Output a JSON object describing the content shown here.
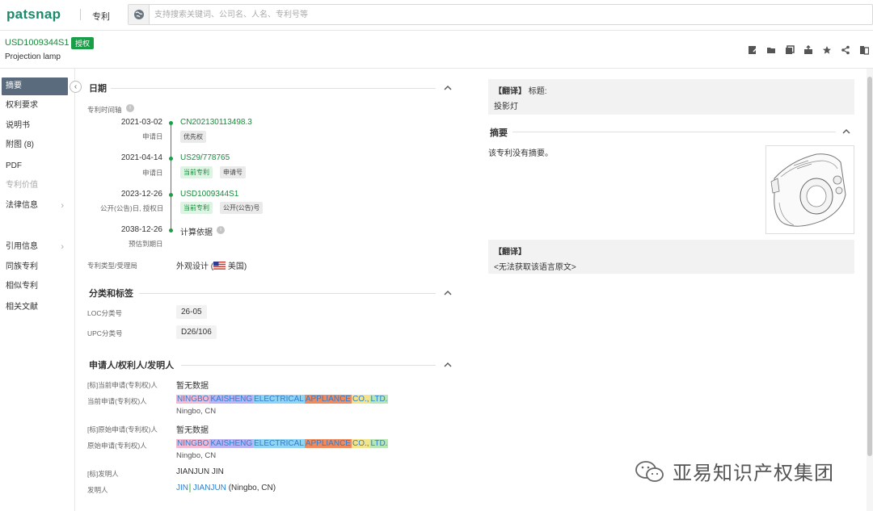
{
  "topbar": {
    "logo": "patsnap",
    "section": "专利",
    "search_placeholder": "支持搜索关键词、公司名、人名、专利号等"
  },
  "header": {
    "patent_no": "USD1009344S1",
    "status_badge": "授权",
    "title": "Projection lamp",
    "tools": [
      "note-icon",
      "folder-icon",
      "copy-icon",
      "export-icon",
      "star-icon",
      "share-icon",
      "compare-icon"
    ]
  },
  "nav": {
    "items": [
      {
        "label": "摘要",
        "active": true
      },
      {
        "label": "权利要求"
      },
      {
        "label": "说明书"
      },
      {
        "label": "附图 (8)"
      },
      {
        "label": "PDF"
      },
      {
        "label": "专利价值",
        "disabled": true
      },
      {
        "label": "法律信息",
        "arrow": true
      },
      {
        "label": "引用信息",
        "arrow": true
      },
      {
        "label": "同族专利"
      },
      {
        "label": "相似专利"
      },
      {
        "label": "相关文献"
      }
    ]
  },
  "dates": {
    "section_title": "日期",
    "timeline_label": "专利时间轴",
    "events": [
      {
        "date": "2021-03-02",
        "sub": "申请日",
        "text": "CN202130113498.3",
        "tags": [
          "优先权"
        ]
      },
      {
        "date": "2021-04-14",
        "sub": "申请日",
        "text": "US29/778765",
        "tags": [
          "当前专利",
          "申请号"
        ]
      },
      {
        "date": "2023-12-26",
        "sub": "公开(公告)日, 授权日",
        "text": "USD1009344S1",
        "tags": [
          "当前专利",
          "公开(公告)号"
        ]
      },
      {
        "date": "2038-12-26",
        "sub": "预估到期日",
        "text": "计算依据",
        "tags": []
      }
    ],
    "type_label": "专利类型/受理局",
    "type_value": "外观设计",
    "office": "美国"
  },
  "classification": {
    "section_title": "分类和标签",
    "loc_label": "LOC分类号",
    "loc_value": "26-05",
    "upc_label": "UPC分类号",
    "upc_value": "D26/106"
  },
  "applicants": {
    "section_title": "申请人/权利人/发明人",
    "rows": [
      {
        "label": "[标]当前申请(专利权)人",
        "value": "暂无数据"
      },
      {
        "label": "当前申请(专利权)人",
        "value": "NINGBO KAISHENG ELECTRICAL APPLIANCE CO., LTD.",
        "location": "Ningbo, CN"
      },
      {
        "label": "[标]原始申请(专利权)人",
        "value": "暂无数据"
      },
      {
        "label": "原始申请(专利权)人",
        "value": "NINGBO KAISHENG ELECTRICAL APPLIANCE CO., LTD.",
        "location": "Ningbo, CN"
      },
      {
        "label": "[标]发明人",
        "value": "JIANJUN JIN"
      },
      {
        "label": "发明人",
        "value_a": "JIN",
        "value_b": "JIANJUN",
        "value_c": "(Ningbo, CN)"
      }
    ],
    "name_parts": [
      "NINGBO",
      "KAISHENG",
      "ELECTRICAL",
      "APPLIANCE",
      "CO.,",
      "LTD."
    ]
  },
  "right": {
    "trans1_label": "【翻译】",
    "trans1_field": "标题:",
    "trans1_value": "投影灯",
    "abstract_title": "摘要",
    "abstract_text": "该专利没有摘要。",
    "trans2_label": "【翻译】",
    "trans2_value": "<无法获取该语言原文>"
  },
  "watermark": "亚易知识产权集团",
  "colors": {
    "brand": "#1a8a6b",
    "granted": "#1a9e47",
    "link": "#2b7fd1"
  }
}
